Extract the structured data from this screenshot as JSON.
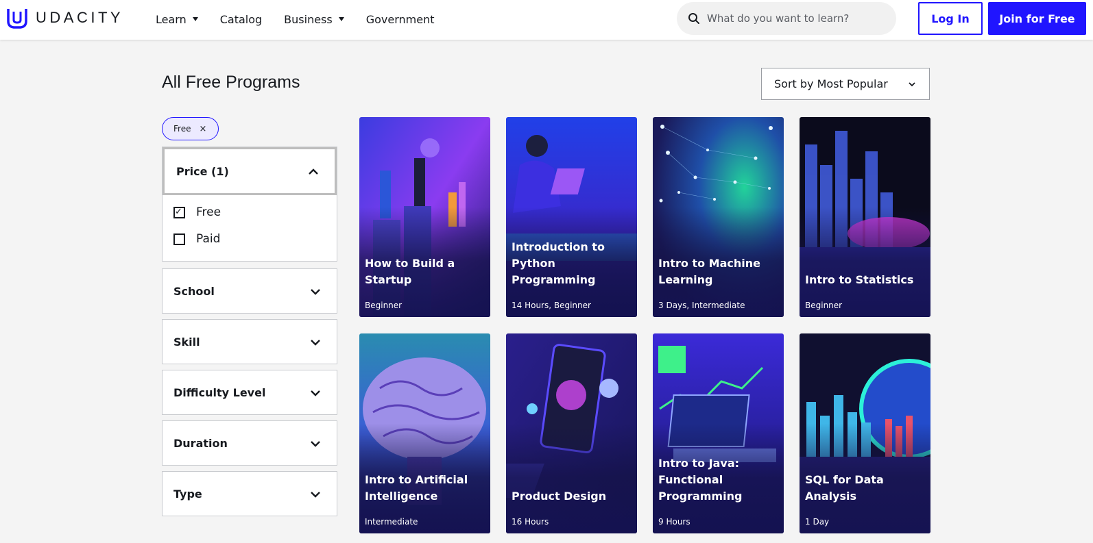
{
  "header": {
    "logo_text": "UDACITY",
    "nav": [
      {
        "label": "Learn",
        "dropdown": true
      },
      {
        "label": "Catalog",
        "dropdown": false
      },
      {
        "label": "Business",
        "dropdown": true
      },
      {
        "label": "Government",
        "dropdown": false
      }
    ],
    "search_placeholder": "What do you want to learn?",
    "login_label": "Log In",
    "join_label": "Join for Free"
  },
  "page": {
    "title": "All Free Programs",
    "sort_label": "Sort by Most Popular"
  },
  "sidebar": {
    "active_chip": "Free",
    "chip_remove_glyph": "×",
    "price_filter": {
      "title": "Price (1)",
      "options": [
        {
          "label": "Free",
          "checked": true
        },
        {
          "label": "Paid",
          "checked": false
        }
      ]
    },
    "filters": [
      "School",
      "Skill",
      "Difficulty Level",
      "Duration",
      "Type"
    ]
  },
  "cards": [
    {
      "title": "How to Build a Startup",
      "meta": "Beginner"
    },
    {
      "title": "Introduction to Python Programming",
      "meta": "14 Hours, Beginner"
    },
    {
      "title": "Intro to Machine Learning",
      "meta": "3 Days, Intermediate"
    },
    {
      "title": "Intro to Statistics",
      "meta": "Beginner"
    },
    {
      "title": "Intro to Artificial Intelligence",
      "meta": "Intermediate"
    },
    {
      "title": "Product Design",
      "meta": "16 Hours"
    },
    {
      "title": "Intro to Java: Functional Programming",
      "meta": "9 Hours"
    },
    {
      "title": "SQL for Data Analysis",
      "meta": "1 Day"
    }
  ],
  "colors": {
    "brand": "#2015ff",
    "page_bg": "#f4f4f4",
    "text": "#171a1f"
  },
  "icons": [
    "udacity-logo-icon",
    "search-icon",
    "chevron-down-icon",
    "chevron-up-icon",
    "close-icon",
    "checkbox-icon"
  ]
}
